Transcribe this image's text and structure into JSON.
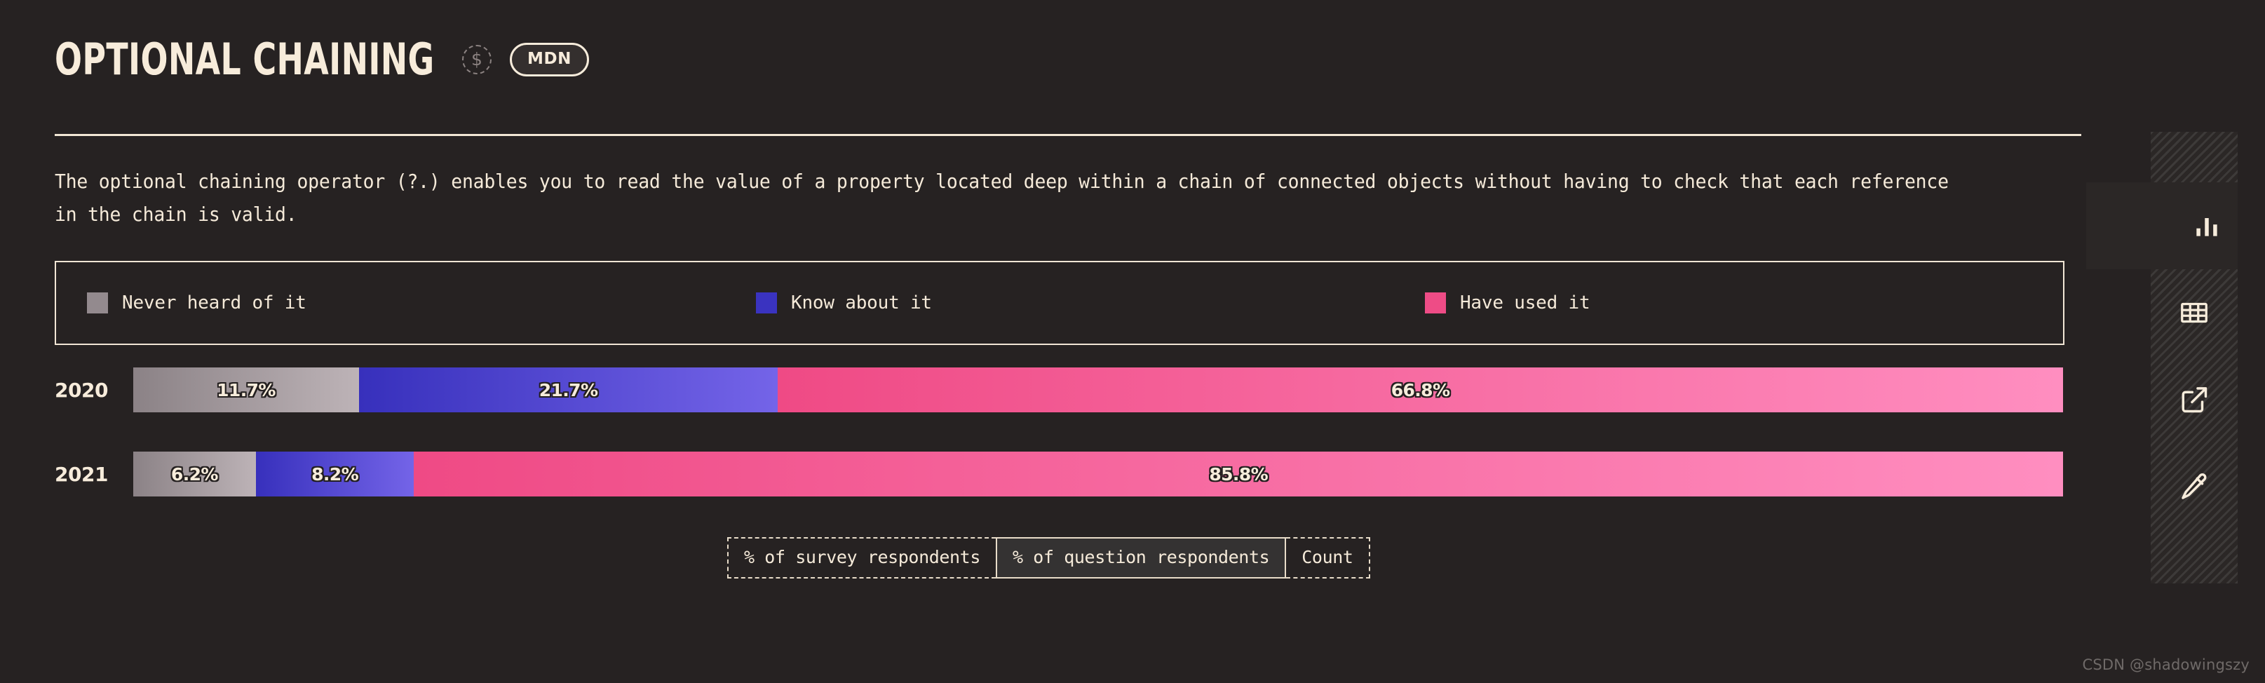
{
  "header": {
    "title": "OPTIONAL CHAINING",
    "dollar_icon_glyph": "$",
    "mdn_badge": "MDN"
  },
  "description": "The optional chaining operator (?.) enables you to read the value of a property located deep within a chain of connected objects without having to check that each reference in the chain is valid.",
  "legend": {
    "items": [
      {
        "label": "Never heard of it",
        "color": "#938a8e"
      },
      {
        "label": "Know about it",
        "color": "#3a33c0"
      },
      {
        "label": "Have used it",
        "color": "#ee4c86"
      }
    ]
  },
  "unit_tabs": [
    {
      "label": "% of survey respondents",
      "active": false
    },
    {
      "label": "% of question respondents",
      "active": true
    },
    {
      "label": "Count",
      "active": false
    }
  ],
  "sidebar": {
    "buttons": [
      {
        "name": "chart-view",
        "icon": "bar-chart-icon",
        "active": true
      },
      {
        "name": "table-view",
        "icon": "table-grid-icon",
        "active": false
      },
      {
        "name": "share-external",
        "icon": "external-link-icon",
        "active": false
      },
      {
        "name": "edit",
        "icon": "pencil-icon",
        "active": false
      }
    ]
  },
  "watermark": "CSDN @shadowingszy",
  "chart_data": {
    "type": "bar",
    "orientation": "horizontal",
    "stacked": true,
    "normalized": true,
    "title": "OPTIONAL CHAINING",
    "xlabel": "",
    "ylabel": "",
    "unit": "% of question respondents",
    "xlim": [
      0,
      100
    ],
    "grid": false,
    "legend_position": "top",
    "categories": [
      "2020",
      "2021"
    ],
    "series": [
      {
        "name": "Never heard of it",
        "color": "#938a8e",
        "values": [
          11.7,
          6.2
        ],
        "labels": [
          "11.7%",
          "6.2%"
        ]
      },
      {
        "name": "Know about it",
        "color": "#3a33c0",
        "values": [
          21.7,
          8.2
        ],
        "labels": [
          "21.7%",
          "8.2%"
        ]
      },
      {
        "name": "Have used it",
        "color": "#ee4c86",
        "values": [
          66.8,
          85.8
        ],
        "labels": [
          "66.8%",
          "85.8%"
        ]
      }
    ],
    "rows": [
      {
        "year": "2020",
        "segments": [
          {
            "series": "Never heard of it",
            "value": 11.7,
            "label": "11.7%"
          },
          {
            "series": "Know about it",
            "value": 21.7,
            "label": "21.7%"
          },
          {
            "series": "Have used it",
            "value": 66.8,
            "label": "66.8%"
          }
        ]
      },
      {
        "year": "2021",
        "segments": [
          {
            "series": "Never heard of it",
            "value": 6.2,
            "label": "6.2%"
          },
          {
            "series": "Know about it",
            "value": 8.2,
            "label": "8.2%"
          },
          {
            "series": "Have used it",
            "value": 85.8,
            "label": "85.8%"
          }
        ]
      }
    ]
  }
}
